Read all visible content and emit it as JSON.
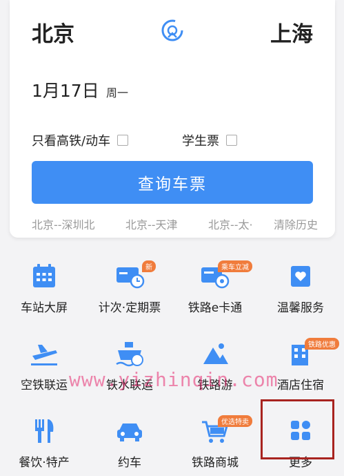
{
  "search": {
    "from_city": "北京",
    "to_city": "上海",
    "date": "1月17日",
    "weekday": "周一",
    "option_highspeed": "只看高铁/动车",
    "option_student": "学生票",
    "button_label": "查询车票",
    "history": [
      "北京--深圳北",
      "北京--天津",
      "北京--太·"
    ],
    "clear_history": "清除历史"
  },
  "services": [
    {
      "label": "车站大屏",
      "icon": "calendar-icon",
      "badge": ""
    },
    {
      "label": "计次·定期票",
      "icon": "ticket-card-icon",
      "badge": "新"
    },
    {
      "label": "铁路e卡通",
      "icon": "ecard-icon",
      "badge": "乘车立减"
    },
    {
      "label": "温馨服务",
      "icon": "heart-box-icon",
      "badge": ""
    },
    {
      "label": "空铁联运",
      "icon": "plane-icon",
      "badge": ""
    },
    {
      "label": "铁水联运",
      "icon": "ship-icon",
      "badge": ""
    },
    {
      "label": "铁路游",
      "icon": "mountain-icon",
      "badge": ""
    },
    {
      "label": "酒店住宿",
      "icon": "hotel-icon",
      "badge": "铁路优惠"
    },
    {
      "label": "餐饮·特产",
      "icon": "fork-knife-icon",
      "badge": ""
    },
    {
      "label": "约车",
      "icon": "car-icon",
      "badge": ""
    },
    {
      "label": "铁路商城",
      "icon": "cart-icon",
      "badge": "优选特卖"
    },
    {
      "label": "更多",
      "icon": "more-grid-icon",
      "badge": ""
    }
  ],
  "watermark": "www.yizhinqin.com",
  "colors": {
    "accent": "#3f8ef4",
    "badge": "#f07c3c",
    "highlight": "#a8231f"
  }
}
